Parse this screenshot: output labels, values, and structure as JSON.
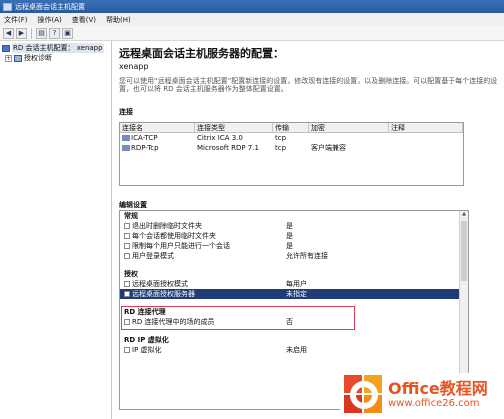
{
  "window": {
    "title": "远程桌面会话主机配置"
  },
  "menu": [
    "文件(F)",
    "操作(A)",
    "查看(V)",
    "帮助(H)"
  ],
  "toolbar": {
    "icons": [
      "back-icon",
      "forward-icon",
      "console-tree-icon",
      "help-icon",
      "properties-icon"
    ]
  },
  "tree": {
    "root_label": "RD 会话主机配置：",
    "root_server": "xenapp",
    "child_label": "授权诊断"
  },
  "main": {
    "heading": "远程桌面会话主机服务器的配置：",
    "server": "xenapp",
    "description": "您可以使用“远程桌面会话主机配置”配置新连接的设置，修改现有连接的设置，以及删除连接。可以配置基于每个连接的设置，也可以将 RD 会话主机服务器作为整体配置设置。",
    "connections_title": "连接",
    "edit_title": "编辑设置"
  },
  "connections": {
    "columns": [
      "连接名",
      "连接类型",
      "传输",
      "加密",
      "注释"
    ],
    "rows": [
      {
        "name": "ICA-TCP",
        "type": "Citrix ICA 3.0",
        "transport": "tcp",
        "encryption": "",
        "comment": ""
      },
      {
        "name": "RDP-Tcp",
        "type": "Microsoft RDP 7.1",
        "transport": "tcp",
        "encryption": "客户端兼容",
        "comment": ""
      }
    ]
  },
  "settings": {
    "general": {
      "title": "常规",
      "rows": [
        {
          "label": "退出时删除临时文件夹",
          "value": "是"
        },
        {
          "label": "每个会话都使用临时文件夹",
          "value": "是"
        },
        {
          "label": "限制每个用户只能进行一个会话",
          "value": "是"
        },
        {
          "label": "用户登录模式",
          "value": "允许所有连接"
        }
      ]
    },
    "licensing": {
      "title": "授权",
      "rows": [
        {
          "label": "远程桌面授权模式",
          "value": "每用户"
        },
        {
          "label": "远程桌面授权服务器",
          "value": "未指定"
        }
      ]
    },
    "broker": {
      "title": "RD 连接代理",
      "rows": [
        {
          "label": "RD 连接代理中的场的成员",
          "value": "否"
        }
      ]
    },
    "ipvirt": {
      "title": "RD IP 虚拟化",
      "rows": [
        {
          "label": "IP 虚拟化",
          "value": "未启用"
        }
      ]
    }
  },
  "watermark": {
    "line1": "Office教程网",
    "line2": "www.office26.com"
  },
  "colors": {
    "selection": "#1f3c78",
    "highlight_box": "#e53b5a",
    "titlebar": "#2a5a9e"
  }
}
